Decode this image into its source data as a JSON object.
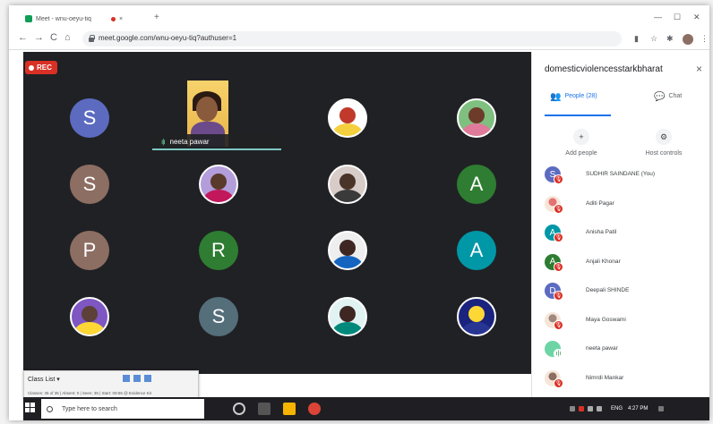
{
  "browser": {
    "tab_title": "Meet - wnu-oeyu-tiq",
    "tab_close": "×",
    "new_tab": "+",
    "url": "meet.google.com/wnu-oeyu-tiq?authuser=1",
    "back": "←",
    "forward": "→",
    "reload": "C",
    "home": "⌂"
  },
  "meet": {
    "rec_label": "REC",
    "presenter_name": "neeta pawar",
    "tiles": [
      {
        "kind": "letter",
        "letter": "S",
        "color": "#5c6bc0"
      },
      {
        "kind": "video"
      },
      {
        "kind": "photo",
        "head": "#c0392b",
        "body": "#f4d03f",
        "bg": "#ffffff"
      },
      {
        "kind": "photo",
        "head": "#6d3b2a",
        "body": "#e07a9a",
        "bg": "#7fbf7f"
      },
      {
        "kind": "letter",
        "letter": "S",
        "color": "#8d6e63"
      },
      {
        "kind": "photo",
        "head": "#5a3a2a",
        "body": "#c2185b",
        "bg": "#b39ddb"
      },
      {
        "kind": "photo",
        "head": "#4a3328",
        "body": "#3a3a3a",
        "bg": "#d7ccc8"
      },
      {
        "kind": "letter",
        "letter": "A",
        "color": "#2e7d32"
      },
      {
        "kind": "letter",
        "letter": "P",
        "color": "#8d6e63"
      },
      {
        "kind": "letter",
        "letter": "R",
        "color": "#2e7d32"
      },
      {
        "kind": "photo",
        "head": "#3e2723",
        "body": "#1565c0",
        "bg": "#eeeeee"
      },
      {
        "kind": "letter",
        "letter": "A",
        "color": "#0097a7"
      },
      {
        "kind": "photo",
        "head": "#5d4037",
        "body": "#fdd835",
        "bg": "#7e57c2"
      },
      {
        "kind": "letter",
        "letter": "S",
        "color": "#546e7a"
      },
      {
        "kind": "photo",
        "head": "#3e2723",
        "body": "#00897b",
        "bg": "#e0f2f1"
      },
      {
        "kind": "photo",
        "head": "#fdd835",
        "body": "#283593",
        "bg": "#1a237e"
      }
    ]
  },
  "panel": {
    "title": "domesticviolencesstarkbharat",
    "close": "×",
    "people_tab": "People (28)",
    "chat_tab": "Chat",
    "add_people": "Add people",
    "host_controls": "Host controls",
    "people": [
      {
        "name": "SUDHIR SAINDANE (You)",
        "letter": "S",
        "color": "#5c6bc0",
        "photo": false,
        "speaking": false
      },
      {
        "name": "Aditi Pagar",
        "letter": "",
        "color": "#e57373",
        "photo": true,
        "speaking": false
      },
      {
        "name": "Anisha Patil",
        "letter": "A",
        "color": "#0097a7",
        "photo": false,
        "speaking": false
      },
      {
        "name": "Anjali Khonar",
        "letter": "A",
        "color": "#2e7d32",
        "photo": false,
        "speaking": false
      },
      {
        "name": "Deepali SHINDE",
        "letter": "D",
        "color": "#5c6bc0",
        "photo": false,
        "speaking": false
      },
      {
        "name": "Maya Goswami",
        "letter": "",
        "color": "#a1887f",
        "photo": true,
        "speaking": false
      },
      {
        "name": "neeta pawar",
        "letter": "",
        "color": "#6dd5a5",
        "photo": false,
        "speaking": true
      },
      {
        "name": "Nimrdi Mankar",
        "letter": "",
        "color": "#8d6e63",
        "photo": true,
        "speaking": false
      }
    ]
  },
  "overlay": {
    "label": "Class List ▾",
    "meta": "Classes: 35 of 35  |  Absent: 0  |  Seen: 35  |  Start: 09:55 @ Evidence Kit"
  },
  "taskbar": {
    "search_placeholder": "Type here to search",
    "lang": "ENG",
    "time": "4:27 PM"
  }
}
